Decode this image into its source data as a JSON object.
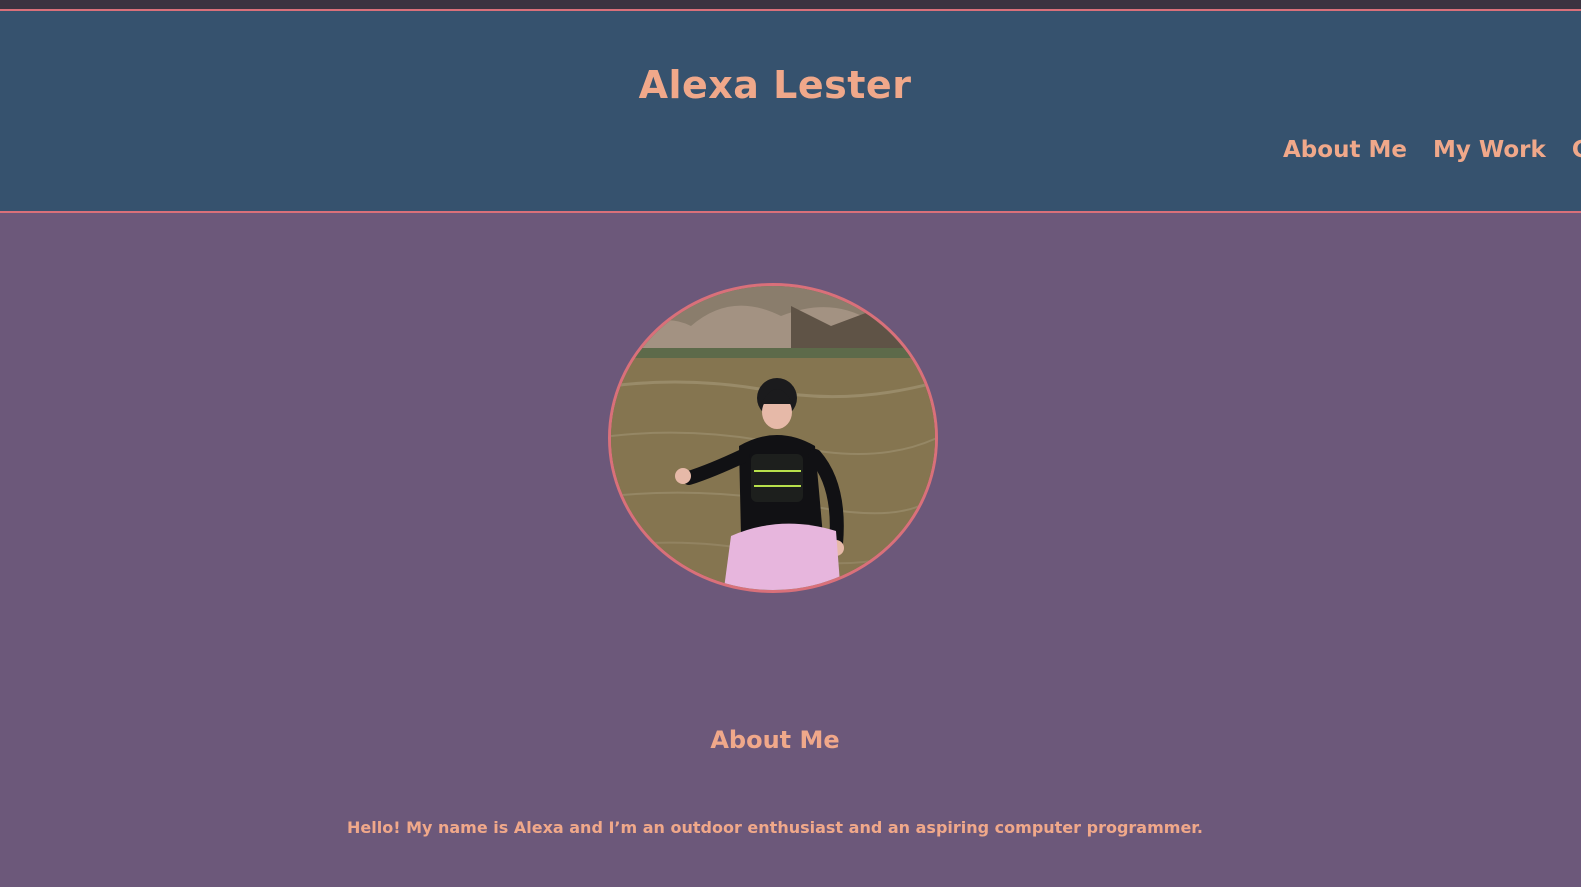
{
  "header": {
    "title": "Alexa Lester",
    "nav": [
      {
        "label": "About Me"
      },
      {
        "label": "My Work"
      },
      {
        "label": "Con"
      }
    ]
  },
  "profile": {
    "alt": "photo of person in kayaking gear standing in a river"
  },
  "about": {
    "heading": "About Me",
    "intro": "Hello! My name is Alexa and I’m an outdoor enthusiast and an aspiring computer programmer."
  },
  "colors": {
    "header_bg": "#36526e",
    "page_bg": "#6c587a",
    "accent_text": "#f0a88a",
    "border": "#d9707a"
  }
}
